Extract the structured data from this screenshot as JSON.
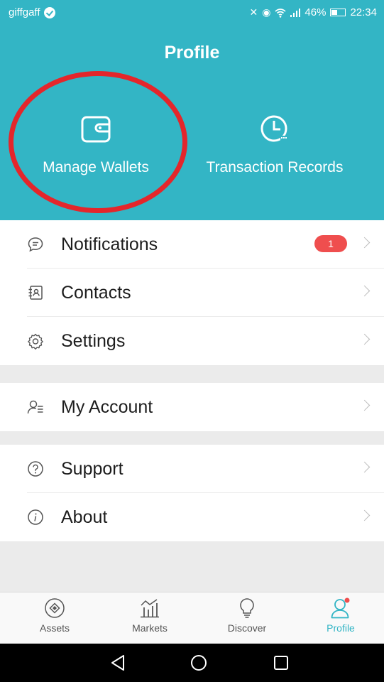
{
  "status": {
    "carrier": "giffgaff",
    "battery": "46%",
    "time": "22:34"
  },
  "header": {
    "title": "Profile",
    "manage_wallets": "Manage Wallets",
    "transaction_records": "Transaction Records"
  },
  "menu": {
    "notifications": {
      "label": "Notifications",
      "badge": "1"
    },
    "contacts": {
      "label": "Contacts"
    },
    "settings": {
      "label": "Settings"
    },
    "my_account": {
      "label": "My Account"
    },
    "support": {
      "label": "Support"
    },
    "about": {
      "label": "About"
    }
  },
  "tabs": [
    {
      "label": "Assets",
      "icon": "assets-icon"
    },
    {
      "label": "Markets",
      "icon": "markets-icon"
    },
    {
      "label": "Discover",
      "icon": "discover-icon"
    },
    {
      "label": "Profile",
      "icon": "profile-icon",
      "active": true
    }
  ],
  "colors": {
    "accent": "#33b5c5",
    "badge": "#ef4e4e",
    "annotation": "#e4262b"
  }
}
